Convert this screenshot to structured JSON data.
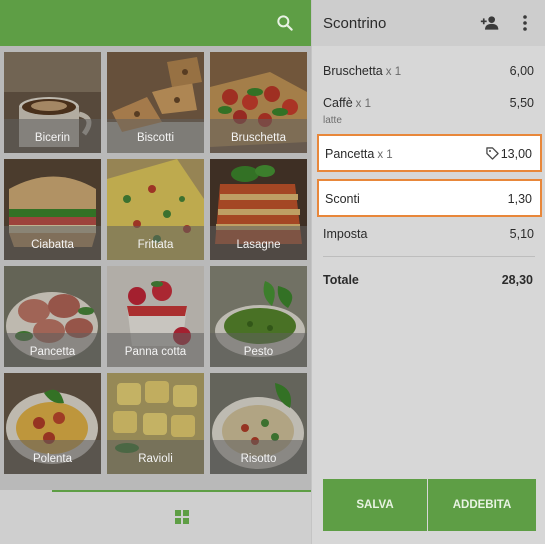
{
  "products": [
    {
      "label": "Bicerin"
    },
    {
      "label": "Biscotti"
    },
    {
      "label": "Bruschetta"
    },
    {
      "label": "Ciabatta"
    },
    {
      "label": "Frittata"
    },
    {
      "label": "Lasagne"
    },
    {
      "label": "Pancetta"
    },
    {
      "label": "Panna cotta"
    },
    {
      "label": "Pesto"
    },
    {
      "label": "Polenta"
    },
    {
      "label": "Ravioli"
    },
    {
      "label": "Risotto"
    }
  ],
  "receipt": {
    "title": "Scontrino",
    "items": [
      {
        "name": "Bruschetta",
        "qty": "x 1",
        "price": "6,00"
      },
      {
        "name": "Caffè",
        "qty": "x 1",
        "price": "5,50",
        "note": "latte"
      },
      {
        "name": "Pancetta",
        "qty": "x 1",
        "price": "13,00"
      }
    ],
    "discount": {
      "label": "Sconti",
      "value": "1,30"
    },
    "tax": {
      "label": "Imposta",
      "value": "5,10"
    },
    "total": {
      "label": "Totale",
      "value": "28,30"
    },
    "buttons": {
      "save": "SALVA",
      "charge": "ADDEBITA"
    }
  },
  "colors": {
    "accent": "#5e9e45",
    "highlight": "#e8873a"
  },
  "icons": [
    "search-icon",
    "add-person-icon",
    "more-vert-icon",
    "tag-icon",
    "grid-icon"
  ]
}
